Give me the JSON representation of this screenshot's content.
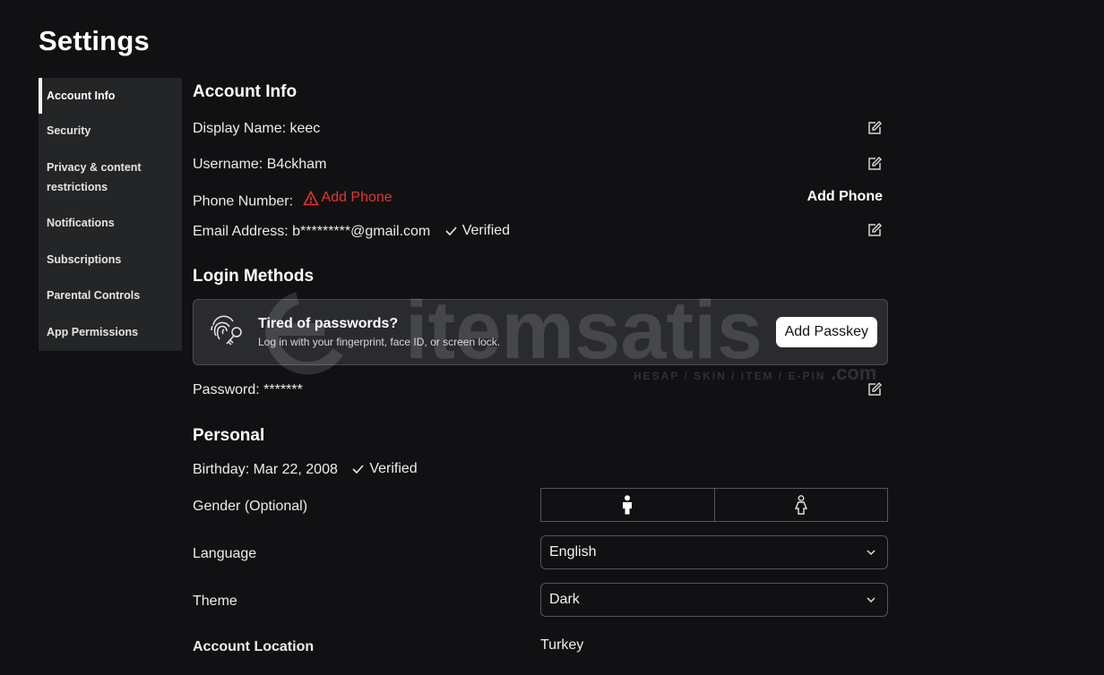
{
  "page": {
    "title": "Settings"
  },
  "sidebar": {
    "items": [
      {
        "label": "Account Info"
      },
      {
        "label": "Security"
      },
      {
        "label": "Privacy & content restrictions"
      },
      {
        "label": "Notifications"
      },
      {
        "label": "Subscriptions"
      },
      {
        "label": "Parental Controls"
      },
      {
        "label": "App Permissions"
      }
    ]
  },
  "account_info": {
    "title": "Account Info",
    "display_name": "Display Name: keec",
    "username": "Username: B4ckham",
    "phone_label": "Phone Number:",
    "phone_warning": "Add Phone",
    "phone_action": "Add Phone",
    "email": "Email Address: b*********@gmail.com",
    "email_status": "Verified"
  },
  "login_methods": {
    "title": "Login Methods",
    "passkey_title": "Tired of passwords?",
    "passkey_subtitle": "Log in with your fingerprint, face ID, or screen lock.",
    "passkey_button": "Add Passkey",
    "password": "Password: *******"
  },
  "personal": {
    "title": "Personal",
    "birthday": "Birthday: Mar 22, 2008",
    "birthday_status": "Verified",
    "gender_label": "Gender (Optional)",
    "language_label": "Language",
    "language_value": "English",
    "theme_label": "Theme",
    "theme_value": "Dark",
    "location_label": "Account Location",
    "location_value": "Turkey"
  },
  "watermark": {
    "brand": "itemsatis",
    "tagline": "HESAP / SKIN / ITEM / E-PIN",
    "suffix": ".com"
  },
  "colors": {
    "background": "#111114",
    "sidebar": "#232527",
    "warning": "#e5362c",
    "card": "#2a2b2f"
  },
  "icons": {
    "edit": "edit-icon",
    "warning": "warning-triangle-icon",
    "check": "check-icon",
    "passkey": "fingerprint-key-icon",
    "gender_male": "male-icon",
    "gender_female": "female-icon",
    "chevron": "chevron-down-icon"
  }
}
